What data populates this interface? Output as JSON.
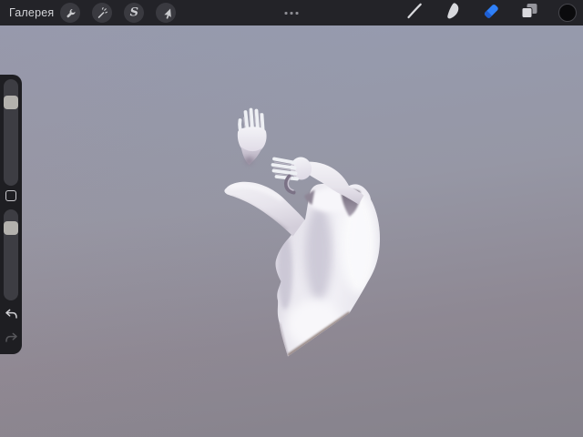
{
  "topbar": {
    "gallery_label": "Галерея",
    "overflow_dots": "•••",
    "left_tools": [
      "actions",
      "adjustments",
      "selection",
      "transform"
    ],
    "right_tools": [
      "paint",
      "smudge",
      "erase",
      "layers",
      "color"
    ],
    "selected_tool": "erase"
  },
  "sidebar": {
    "brush_size_handle_pct": 15,
    "opacity_handle_pct": 13,
    "undo_enabled": true,
    "redo_enabled": false
  },
  "canvas": {
    "content": "3d-model-female-torso-raised-arms-detached-hand"
  },
  "colors": {
    "accent": "#2f80f8",
    "accent-dark": "#1e5ed2",
    "topbar-bg": "#232328",
    "panel-bg": "#1e1e22",
    "track": "#3d3d43",
    "handle": "#b3b1ad",
    "current-color": "#0b0b0d",
    "bg-top": "#969cb1",
    "bg-mid": "#9697a5",
    "bg-low": "#8e8893",
    "bg-bottom": "#85828b",
    "model": "#eef0f4"
  }
}
